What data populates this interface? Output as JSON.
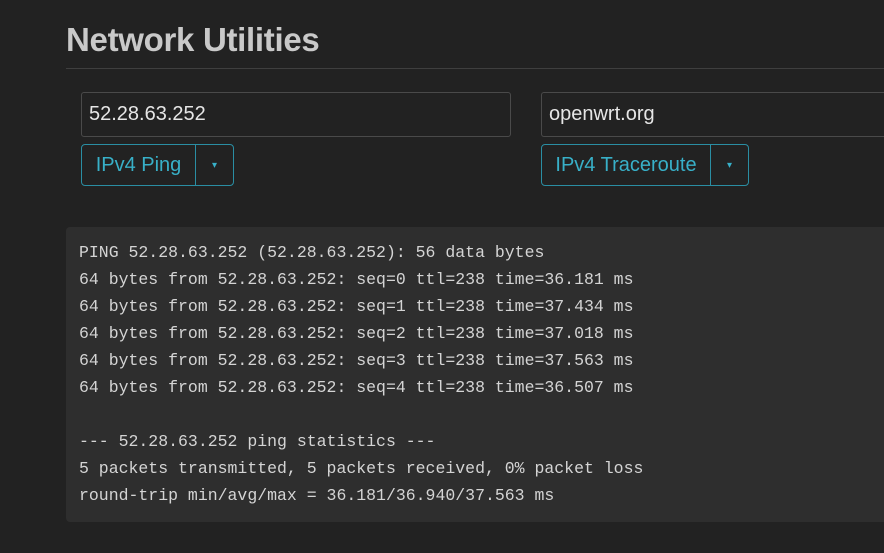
{
  "page": {
    "title": "Network Utilities"
  },
  "ping": {
    "target_value": "52.28.63.252",
    "button_label": "IPv4 Ping",
    "toggle_glyph": "▾"
  },
  "traceroute": {
    "target_value": "openwrt.org",
    "button_label": "IPv4 Traceroute",
    "toggle_glyph": "▾"
  },
  "output": {
    "lines": [
      "PING 52.28.63.252 (52.28.63.252): 56 data bytes",
      "64 bytes from 52.28.63.252: seq=0 ttl=238 time=36.181 ms",
      "64 bytes from 52.28.63.252: seq=1 ttl=238 time=37.434 ms",
      "64 bytes from 52.28.63.252: seq=2 ttl=238 time=37.018 ms",
      "64 bytes from 52.28.63.252: seq=3 ttl=238 time=37.563 ms",
      "64 bytes from 52.28.63.252: seq=4 ttl=238 time=36.507 ms",
      "",
      "--- 52.28.63.252 ping statistics ---",
      "5 packets transmitted, 5 packets received, 0% packet loss",
      "round-trip min/avg/max = 36.181/36.940/37.563 ms"
    ]
  },
  "colors": {
    "background": "#222222",
    "accent": "#38b0c8",
    "output_background": "#2e2e2e"
  },
  "icons": {
    "dropdown_toggle": "caret-down-icon"
  }
}
